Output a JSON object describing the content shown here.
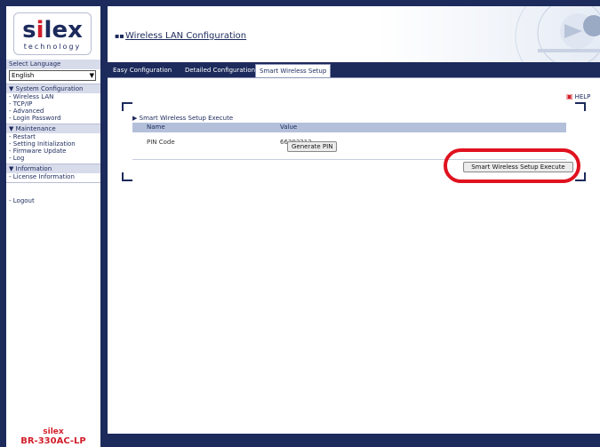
{
  "logo": {
    "brand": "silex",
    "tagline": "technology"
  },
  "sidebar": {
    "language_label": "Select Language",
    "language_value": "English",
    "sections": [
      {
        "title": "System Configuration",
        "items": [
          "Wireless LAN",
          "TCP/IP",
          "Advanced",
          "Login Password"
        ]
      },
      {
        "title": "Maintenance",
        "items": [
          "Restart",
          "Setting Initialization",
          "Firmware Update",
          "Log"
        ]
      },
      {
        "title": "Information",
        "items": [
          "License Information"
        ]
      }
    ],
    "logout": "Logout",
    "footer_brand": "silex",
    "footer_model": "BR-330AC-LP"
  },
  "header": {
    "title": "Wireless LAN Configuration"
  },
  "tabs": [
    "Easy Configuration",
    "Detailed Configuration",
    "Smart Wireless Setup"
  ],
  "active_tab": "Smart Wireless Setup",
  "help_label": "HELP",
  "section": {
    "title": "Smart Wireless Setup Execute",
    "col_name": "Name",
    "col_value": "Value",
    "row_label": "PIN Code",
    "pin_value": "66303213",
    "generate_label": "Generate PIN",
    "execute_label": "Smart Wireless Setup Execute"
  },
  "colors": {
    "navy": "#1c2a5c",
    "highlight": "#e0121f",
    "brand_red": "#d21f2b"
  },
  "icons": [
    "chevron-down-icon",
    "triangle-bullet-icon",
    "help-icon"
  ]
}
